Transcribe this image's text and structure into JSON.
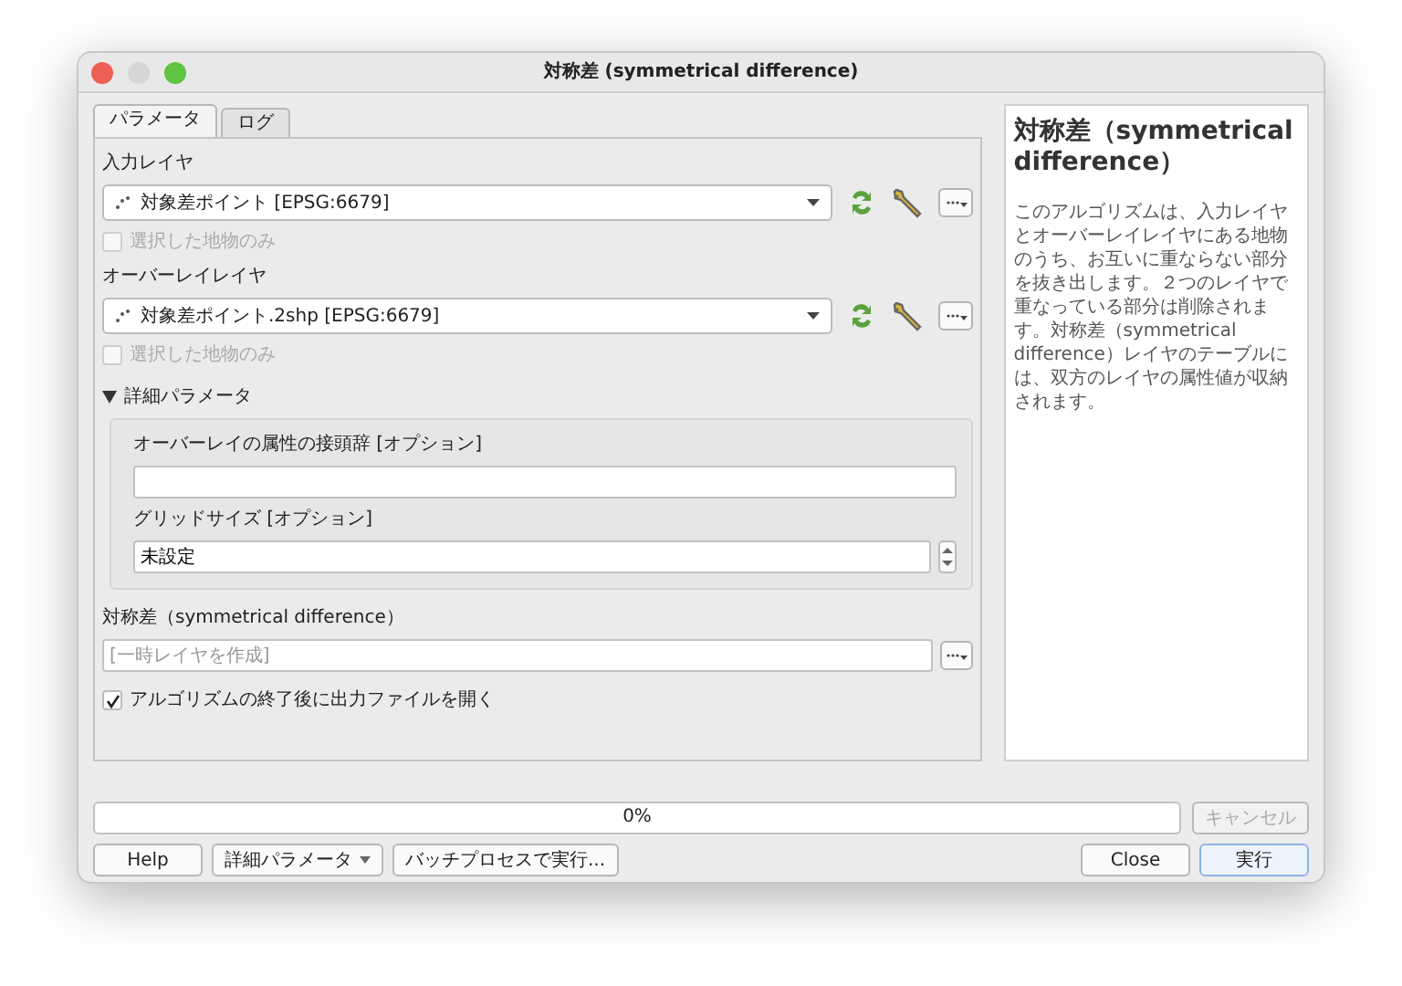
{
  "window": {
    "title": "対称差 (symmetrical difference)"
  },
  "tabs": [
    {
      "label": "パラメータ",
      "selected": true
    },
    {
      "label": "ログ",
      "selected": false
    }
  ],
  "layers": [
    {
      "label": "入力レイヤ",
      "value": "対象差ポイント [EPSG:6679]",
      "selected_only": {
        "label": "選択した地物のみ",
        "checked": false,
        "disabled": true
      }
    },
    {
      "label": "オーバーレイレイヤ",
      "value": "対象差ポイント.2shp [EPSG:6679]",
      "selected_only": {
        "label": "選択した地物のみ",
        "checked": false,
        "disabled": true
      }
    }
  ],
  "advanced": {
    "label": "詳細パラメータ",
    "expanded": true,
    "fields": [
      {
        "kind": "text",
        "label": "オーバーレイの属性の接頭辞 [オプション]"
      },
      {
        "kind": "spin",
        "label": "グリッドサイズ [オプション]",
        "value": "未設定"
      }
    ]
  },
  "output": {
    "label": "対称差（symmetrical difference）",
    "placeholder": "[一時レイヤを作成]"
  },
  "open_after": {
    "label": "アルゴリズムの終了後に出力ファイルを開く",
    "checked": true
  },
  "help": {
    "title": "対称差（symmetrical difference）",
    "body": "このアルゴリズムは、入力レイヤとオーバーレイレイヤにある地物のうち、お互いに重ならない部分を抜き出します。２つのレイヤで重なっている部分は削除されます。対称差（symmetrical difference）レイヤのテーブルには、双方のレイヤの属性値が収納されます。"
  },
  "progress": {
    "level": 0,
    "reading": "0%"
  },
  "cancel": {
    "label": "キャンセル",
    "disabled": true
  },
  "buttons": [
    {
      "kind": "plain",
      "label": "Help"
    },
    {
      "kind": "dropdown",
      "label": "詳細パラメータ"
    },
    {
      "kind": "plain",
      "label": "バッチプロセスで実行..."
    },
    {
      "kind": "spacer"
    },
    {
      "kind": "plain",
      "label": "Close"
    },
    {
      "kind": "default",
      "label": "実行"
    }
  ]
}
